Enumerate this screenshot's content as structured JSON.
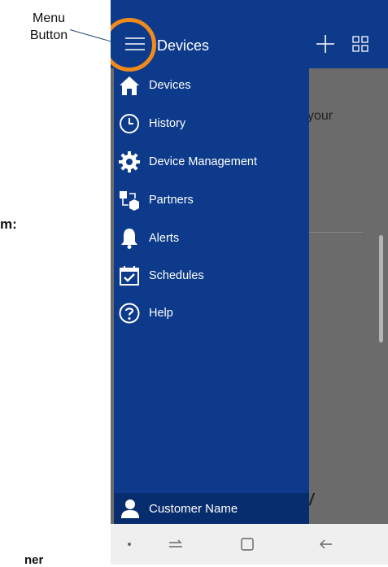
{
  "annotation": {
    "label": "Menu\nButton",
    "line1": "Menu",
    "line2": "Button",
    "cut_colon": "m:",
    "cut_bottom": "ner"
  },
  "app_bar": {
    "title": "Devices",
    "color": "#0d3a8a"
  },
  "content": {
    "partial_text": "your",
    "partial_italic": "/"
  },
  "drawer": {
    "items": [
      {
        "label": "Devices",
        "icon": "home-icon"
      },
      {
        "label": "History",
        "icon": "clock-icon"
      },
      {
        "label": "Device Management",
        "icon": "gear-icon"
      },
      {
        "label": "Partners",
        "icon": "partners-icon"
      },
      {
        "label": "Alerts",
        "icon": "bell-icon"
      },
      {
        "label": "Schedules",
        "icon": "calendar-check-icon"
      },
      {
        "label": "Help",
        "icon": "help-icon"
      }
    ],
    "footer_label": "Customer Name",
    "footer_icon": "user-icon"
  },
  "colors": {
    "accent_ring": "#f08a1c",
    "drawer_bg": "#0d3a8a"
  }
}
